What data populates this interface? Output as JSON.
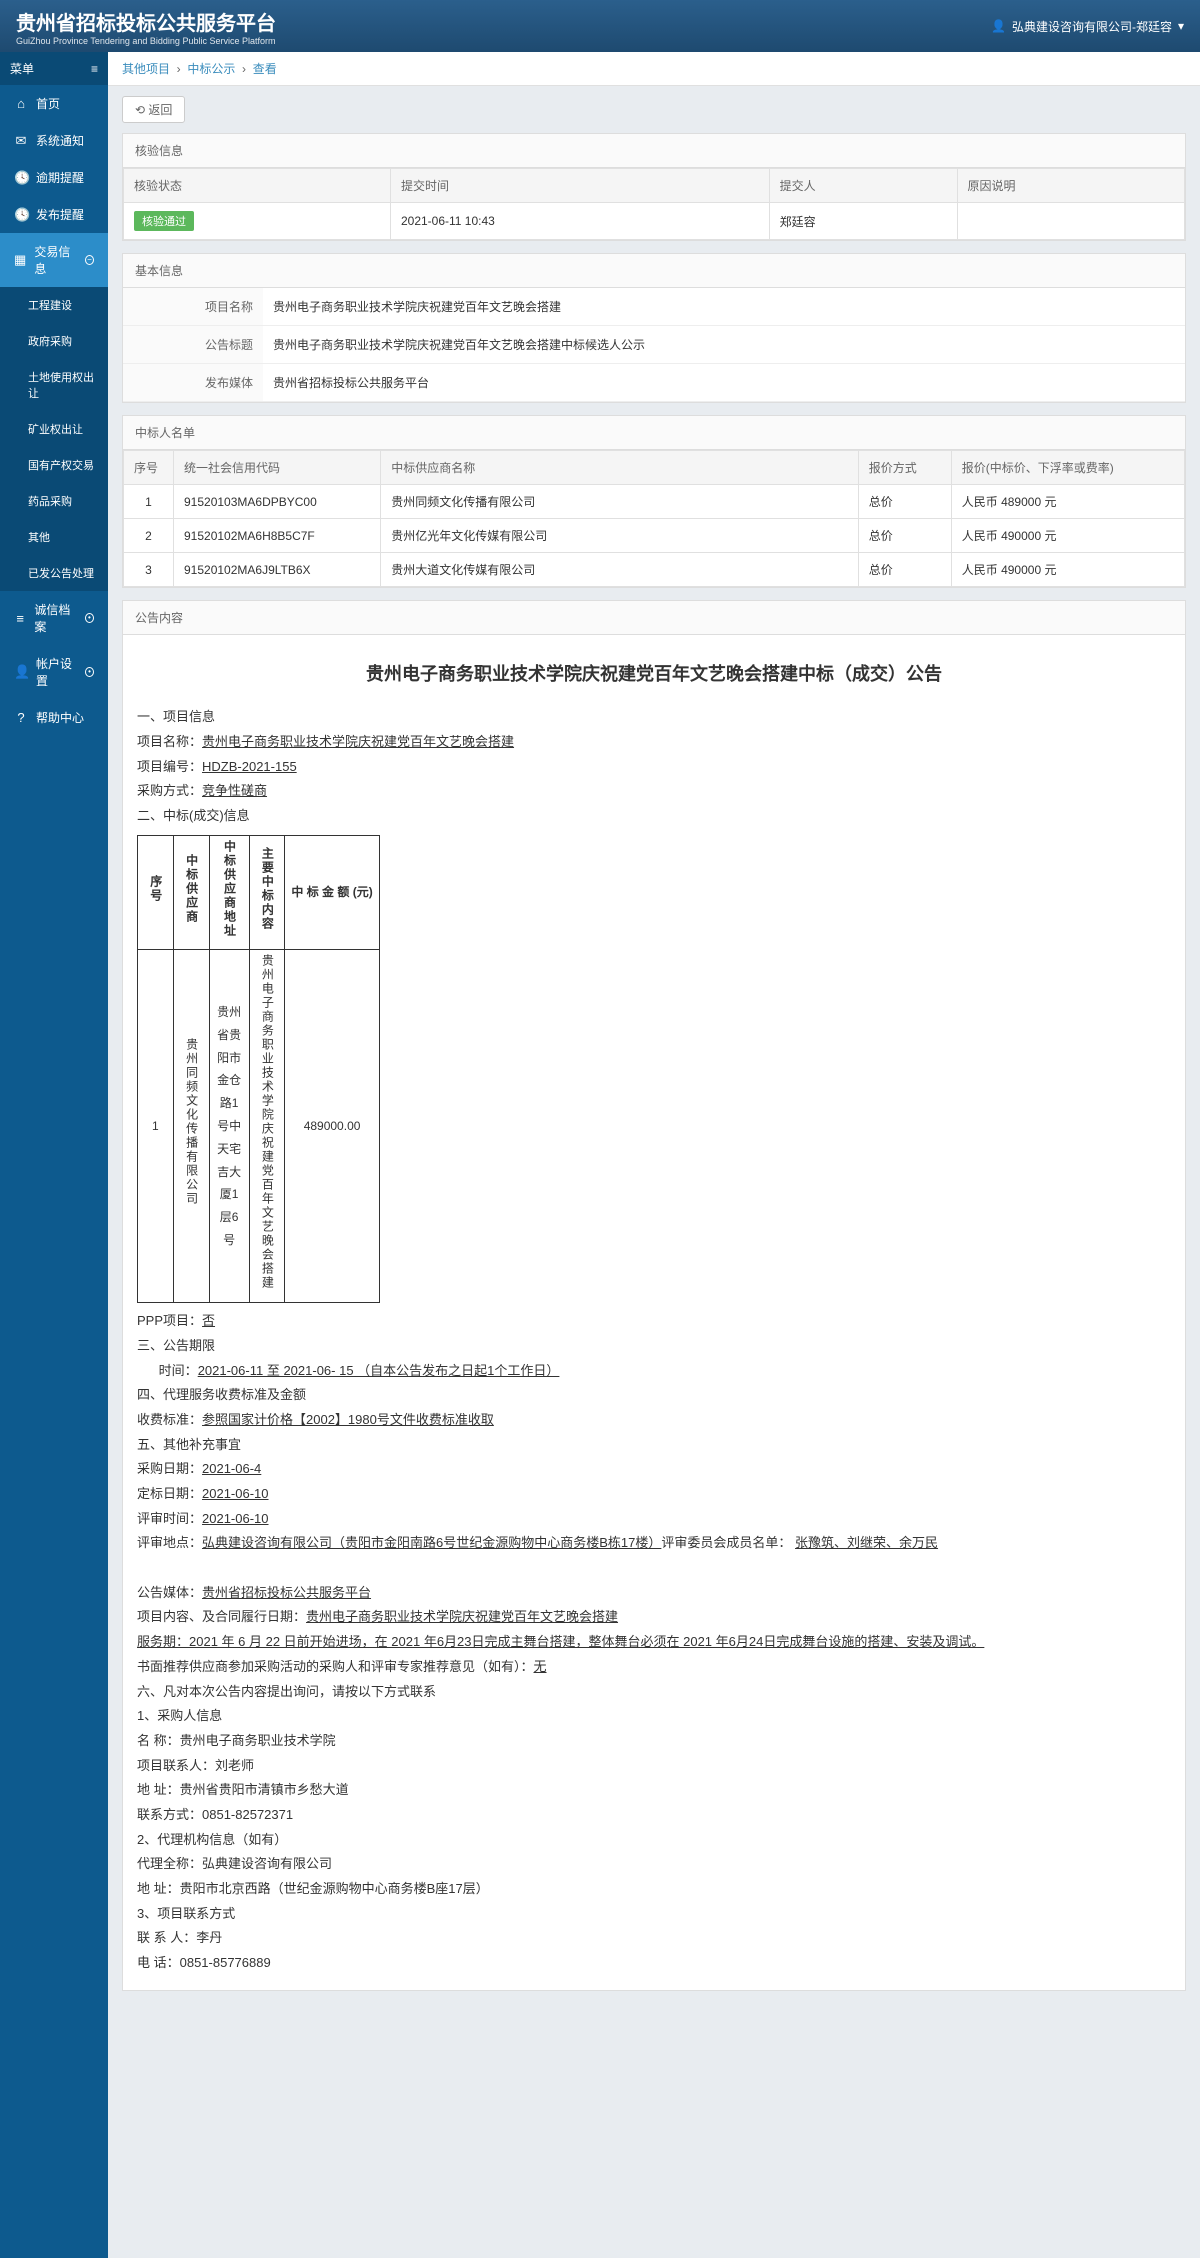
{
  "header": {
    "title": "贵州省招标投标公共服务平台",
    "sub": "GuiZhou Province Tendering and Bidding Public Service Platform",
    "user": "弘典建设咨询有限公司-郑廷容"
  },
  "sidebar": {
    "menuLabel": "菜单",
    "items": [
      {
        "icon": "⌂",
        "label": "首页"
      },
      {
        "icon": "✉",
        "label": "系统通知"
      },
      {
        "icon": "🕓",
        "label": "逾期提醒"
      },
      {
        "icon": "🕓",
        "label": "发布提醒"
      },
      {
        "icon": "▦",
        "label": "交易信息",
        "active": true,
        "expand": true
      },
      {
        "icon": "≡",
        "label": "诚信档案",
        "badge": true
      },
      {
        "icon": "👤",
        "label": "帐户设置",
        "badge": true
      },
      {
        "icon": "?",
        "label": "帮助中心"
      }
    ],
    "sub": [
      "工程建设",
      "政府采购",
      "土地使用权出让",
      "矿业权出让",
      "国有产权交易",
      "药品采购",
      "其他",
      "已发公告处理"
    ]
  },
  "breadcrumb": {
    "a": "其他项目",
    "b": "中标公示",
    "c": "查看"
  },
  "backBtn": "返回",
  "verify": {
    "title": "核验信息",
    "cols": [
      "核验状态",
      "提交时间",
      "提交人",
      "原因说明"
    ],
    "status": "核验通过",
    "time": "2021-06-11 10:43",
    "person": "郑廷容",
    "reason": ""
  },
  "basic": {
    "title": "基本信息",
    "rows": [
      {
        "k": "项目名称",
        "v": "贵州电子商务职业技术学院庆祝建党百年文艺晚会搭建"
      },
      {
        "k": "公告标题",
        "v": "贵州电子商务职业技术学院庆祝建党百年文艺晚会搭建中标候选人公示"
      },
      {
        "k": "发布媒体",
        "v": "贵州省招标投标公共服务平台"
      }
    ]
  },
  "winners": {
    "title": "中标人名单",
    "cols": [
      "序号",
      "统一社会信用代码",
      "中标供应商名称",
      "报价方式",
      "报价(中标价、下浮率或费率)"
    ],
    "rows": [
      {
        "no": "1",
        "code": "91520103MA6DPBYC00",
        "name": "贵州同频文化传播有限公司",
        "way": "总价",
        "price": "人民币 489000 元"
      },
      {
        "no": "2",
        "code": "91520102MA6H8B5C7F",
        "name": "贵州亿光年文化传媒有限公司",
        "way": "总价",
        "price": "人民币 490000 元"
      },
      {
        "no": "3",
        "code": "91520102MA6J9LTB6X",
        "name": "贵州大道文化传媒有限公司",
        "way": "总价",
        "price": "人民币 490000 元"
      }
    ]
  },
  "announce": {
    "panelTitle": "公告内容",
    "title": "贵州电子商务职业技术学院庆祝建党百年文艺晚会搭建中标（成交）公告",
    "sec1": "一、项目信息",
    "projName": {
      "k": "项目名称：",
      "v": "贵州电子商务职业技术学院庆祝建党百年文艺晚会搭建"
    },
    "projCode": {
      "k": "项目编号：",
      "v": "HDZB-2021-155"
    },
    "method": {
      "k": "采购方式：",
      "v": "竞争性磋商"
    },
    "sec2": "二、中标(成交)信息",
    "tbl": {
      "cols": [
        "序号",
        "中标供应商",
        "中标供应商地址",
        "主要中标内容",
        "中 标 金 额 (元)"
      ],
      "row": {
        "no": "1",
        "supplier": "贵州同频文化传播有限公司",
        "addr": "贵州省贵阳市金仓路1号中天宅吉大厦1层6号",
        "content": "贵州电子商务职业技术学院庆祝建党百年文艺晚会搭建",
        "amount": "489000.00"
      }
    },
    "ppp": {
      "k": "PPP项目：",
      "v": "否"
    },
    "sec3": "三、公告期限",
    "period": {
      "k": "时间：",
      "v": "2021-06-11  至  2021-06-   15 （自本公告发布之日起1个工作日）"
    },
    "sec4": "四、代理服务收费标准及金额",
    "fee": {
      "k": "收费标准：",
      "v": "参照国家计价格【2002】1980号文件收费标准收取"
    },
    "sec5": "五、其他补充事宜",
    "buyDate": {
      "k": "采购日期：",
      "v": "2021-06-4"
    },
    "fixDate": {
      "k": "定标日期：",
      "v": "2021-06-10"
    },
    "reviewTime": {
      "k": "评审时间：",
      "v": "2021-06-10"
    },
    "reviewPlace": {
      "k": "评审地点：",
      "v1": "弘典建设咨询有限公司（贵阳市金阳南路6号世纪金源购物中心商务楼B栋17楼）",
      "k2": "评审委员会成员名单：   ",
      "v2": "张豫筑、刘继荣、余万民"
    },
    "media": {
      "k": "公告媒体：",
      "v": "贵州省招标投标公共服务平台"
    },
    "contract": {
      "k": "项目内容、及合同履行日期：",
      "v": "贵州电子商务职业技术学院庆祝建党百年文艺晚会搭建"
    },
    "service": "服务期：2021 年  6 月  22 日前开始进场，在  2021 年6月23日完成主舞台搭建，整体舞台必须在  2021 年6月24日完成舞台设施的搭建、安装及调试。",
    "recommend": {
      "k": "书面推荐供应商参加采购活动的采购人和评审专家推荐意见（如有）：",
      "v": "无"
    },
    "sec6": "六、凡对本次公告内容提出询问，请按以下方式联系",
    "p1": "1、采购人信息",
    "buyerName": "名         称：贵州电子商务职业技术学院",
    "buyerContact": "项目联系人：刘老师",
    "buyerAddr": "地         址：贵州省贵阳市清镇市乡愁大道",
    "buyerTel": "联系方式：0851-82572371",
    "p2": "2、代理机构信息（如有）",
    "agentName": "代理全称：弘典建设咨询有限公司",
    "agentAddr": "地         址：贵阳市北京西路（世纪金源购物中心商务楼B座17层）",
    "p3": "3、项目联系方式",
    "pmName": "联  系  人：李丹",
    "pmTel": "电         话：0851-85776889"
  }
}
